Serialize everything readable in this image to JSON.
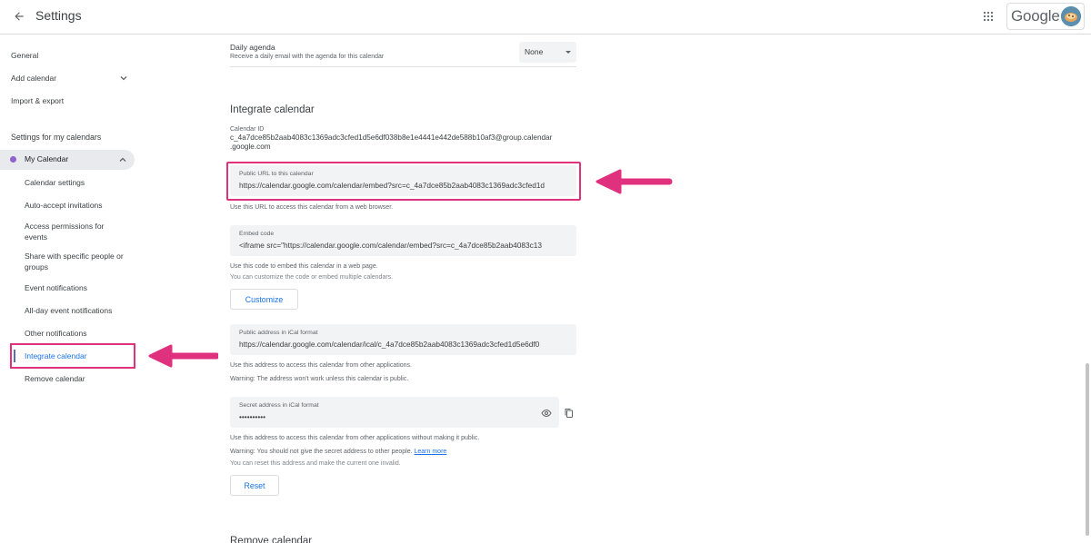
{
  "header": {
    "title": "Settings",
    "brand": "Google"
  },
  "sidebar": {
    "general": "General",
    "add_calendar": "Add calendar",
    "import_export": "Import & export",
    "settings_heading": "Settings for my calendars",
    "my_calendar": "My Calendar",
    "sub_items": [
      "Calendar settings",
      "Auto-accept invitations",
      "Access permissions for events",
      "Share with specific people or groups",
      "Event notifications",
      "All-day event notifications",
      "Other notifications",
      "Integrate calendar",
      "Remove calendar"
    ]
  },
  "daily_agenda": {
    "title": "Daily agenda",
    "description": "Receive a daily email with the agenda for this calendar",
    "selected": "None"
  },
  "integrate": {
    "title": "Integrate calendar",
    "calendar_id_label": "Calendar ID",
    "calendar_id_line1": "c_4a7dce85b2aab4083c1369adc3cfed1d5e6df038b8e1e4441e442de588b10af3@group.calendar",
    "calendar_id_line2": ".google.com",
    "public_url_label": "Public URL to this calendar",
    "public_url_value": "https://calendar.google.com/calendar/embed?src=c_4a7dce85b2aab4083c1369adc3cfed1d",
    "public_url_help": "Use this URL to access this calendar from a web browser.",
    "embed_label": "Embed code",
    "embed_value": "<iframe src=\"https://calendar.google.com/calendar/embed?src=c_4a7dce85b2aab4083c13",
    "embed_help1": "Use this code to embed this calendar in a web page.",
    "embed_help2": "You can customize the code or embed multiple calendars.",
    "customize_button": "Customize",
    "ical_public_label": "Public address in iCal format",
    "ical_public_value": "https://calendar.google.com/calendar/ical/c_4a7dce85b2aab4083c1369adc3cfed1d5e6df0",
    "ical_public_help1": "Use this address to access this calendar from other applications.",
    "ical_public_help2": "Warning: The address won't work unless this calendar is public.",
    "ical_secret_label": "Secret address in iCal format",
    "ical_secret_value": "••••••••••",
    "ical_secret_help1": "Use this address to access this calendar from other applications without making it public.",
    "ical_secret_help2": "Warning: You should not give the secret address to other people.",
    "learn_more": "Learn more",
    "ical_secret_help3": "You can reset this address and make the current one invalid.",
    "reset_button": "Reset"
  },
  "next_section": {
    "title": "Remove calendar"
  },
  "colors": {
    "accent": "#1a73e8",
    "highlight": "#e0317f",
    "calendar_dot": "#8e63ce"
  }
}
